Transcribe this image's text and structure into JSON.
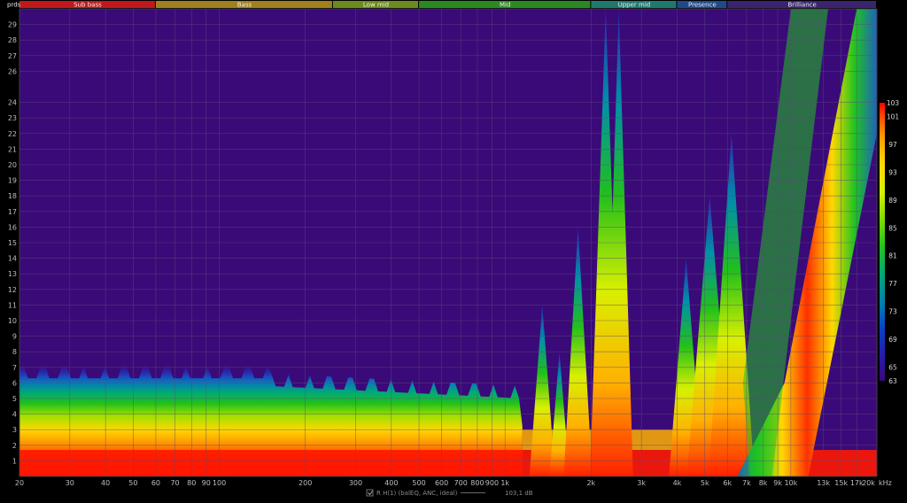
{
  "chart_data": {
    "type": "heatmap",
    "xlabel": "",
    "ylabel": "prds",
    "x_unit_label": "kHz",
    "x_scale": "log",
    "xlim": [
      20,
      20000
    ],
    "ylim": [
      0,
      30
    ],
    "grid": true,
    "x_ticks": [
      {
        "value": 20,
        "label": "20"
      },
      {
        "value": 30,
        "label": "30"
      },
      {
        "value": 40,
        "label": "40"
      },
      {
        "value": 50,
        "label": "50"
      },
      {
        "value": 60,
        "label": "60"
      },
      {
        "value": 70,
        "label": "70"
      },
      {
        "value": 80,
        "label": "80"
      },
      {
        "value": 90,
        "label": "90"
      },
      {
        "value": 100,
        "label": "100"
      },
      {
        "value": 200,
        "label": "200"
      },
      {
        "value": 300,
        "label": "300"
      },
      {
        "value": 400,
        "label": "400"
      },
      {
        "value": 500,
        "label": "500"
      },
      {
        "value": 600,
        "label": "600"
      },
      {
        "value": 700,
        "label": "700"
      },
      {
        "value": 800,
        "label": "800"
      },
      {
        "value": 900,
        "label": "900"
      },
      {
        "value": 1000,
        "label": "1k"
      },
      {
        "value": 2000,
        "label": "2k"
      },
      {
        "value": 3000,
        "label": "3k"
      },
      {
        "value": 4000,
        "label": "4k"
      },
      {
        "value": 5000,
        "label": "5k"
      },
      {
        "value": 6000,
        "label": "6k"
      },
      {
        "value": 7000,
        "label": "7k"
      },
      {
        "value": 8000,
        "label": "8k"
      },
      {
        "value": 9000,
        "label": "9k"
      },
      {
        "value": 10000,
        "label": "10k"
      },
      {
        "value": 13000,
        "label": "13k"
      },
      {
        "value": 15000,
        "label": "15k"
      },
      {
        "value": 17000,
        "label": "17k"
      },
      {
        "value": 20000,
        "label": "20k"
      }
    ],
    "y_ticks": [
      1,
      2,
      3,
      4,
      5,
      6,
      7,
      8,
      9,
      10,
      11,
      12,
      13,
      14,
      15,
      16,
      17,
      18,
      19,
      20,
      21,
      22,
      23,
      24,
      26,
      27,
      28,
      29
    ],
    "bands": [
      {
        "name": "Sub bass",
        "from": 20,
        "to": 60,
        "color": "#c0181c"
      },
      {
        "name": "Bass",
        "from": 60,
        "to": 250,
        "color": "#a0801c"
      },
      {
        "name": "Low mid",
        "from": 250,
        "to": 500,
        "color": "#6e8a1c"
      },
      {
        "name": "Mid",
        "from": 500,
        "to": 2000,
        "color": "#2a8a22"
      },
      {
        "name": "Upper mid",
        "from": 2000,
        "to": 4000,
        "color": "#1f7a6e"
      },
      {
        "name": "Presence",
        "from": 4000,
        "to": 6000,
        "color": "#1e4a8a"
      },
      {
        "name": "Brilliance",
        "from": 6000,
        "to": 20000,
        "color": "#3a2470"
      }
    ],
    "colorbar": {
      "min": 63,
      "max": 103,
      "tick_labels": [
        103,
        101,
        97,
        93,
        89,
        85,
        81,
        77,
        73,
        69,
        65,
        63
      ],
      "colors": [
        "#ff0000",
        "#ff4a00",
        "#ff9900",
        "#ffd800",
        "#d8f000",
        "#7fdc00",
        "#1fc41f",
        "#00a87a",
        "#0080b0",
        "#0a3ec8",
        "#2a18a8",
        "#3a0a78"
      ]
    },
    "background_color": "#3a0a78",
    "series": [
      {
        "name": "R H(1) (balEQ, ANC, ideal)",
        "peak_db": "103,1 dB"
      }
    ]
  }
}
